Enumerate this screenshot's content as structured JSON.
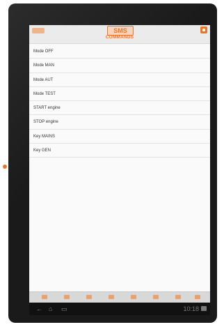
{
  "header": {
    "logo_text": "SMS",
    "screen_title": "COMMANDS"
  },
  "commands": [
    {
      "label": "Mode OFF"
    },
    {
      "label": "Mode MAN"
    },
    {
      "label": "Mode AUT"
    },
    {
      "label": "Mode TEST"
    },
    {
      "label": "START engine"
    },
    {
      "label": "STOP engine"
    },
    {
      "label": "Key MAINS"
    },
    {
      "label": "Key GEN"
    }
  ],
  "system_bar": {
    "nav": {
      "back_glyph": "←",
      "home_glyph": "⌂",
      "recents_glyph": "▭"
    },
    "time": "10:18"
  },
  "colors": {
    "accent": "#e8772e",
    "header_bg": "#ebebeb",
    "toolbar_bg": "#d8d8d8",
    "system_bar_bg": "#111111"
  },
  "icons": {
    "toolbar": [
      "home-icon",
      "tool-icon",
      "arrow-icon",
      "chart-icon",
      "alarm-icon",
      "settings-icon",
      "info-icon",
      "exit-icon"
    ],
    "header": [
      "menu-icon",
      "window-icon"
    ]
  }
}
